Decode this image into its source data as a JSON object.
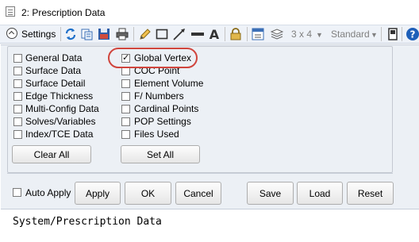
{
  "window": {
    "title": "2: Prescription Data"
  },
  "toolbar": {
    "settings_label": "Settings",
    "layout_value": "3 x 4",
    "style_value": "Standard",
    "icons": [
      "chevron-up-icon",
      "refresh-icon",
      "copy-icon",
      "save-icon",
      "print-icon",
      "pencil-icon",
      "rectangle-icon",
      "line-icon",
      "thick-line-icon",
      "text-icon",
      "lock-icon",
      "window-icon",
      "layers-icon",
      "dropdown-arrow-icon",
      "dropdown-arrow-icon",
      "panel-icon",
      "help-icon"
    ]
  },
  "options": {
    "left": [
      {
        "label": "General Data",
        "checked": false
      },
      {
        "label": "Surface Data",
        "checked": false
      },
      {
        "label": "Surface Detail",
        "checked": false
      },
      {
        "label": "Edge Thickness",
        "checked": false
      },
      {
        "label": "Multi-Config Data",
        "checked": false
      },
      {
        "label": "Solves/Variables",
        "checked": false
      },
      {
        "label": "Index/TCE Data",
        "checked": false
      }
    ],
    "right": [
      {
        "label": "Global Vertex",
        "checked": true
      },
      {
        "label": "COC Point",
        "checked": false
      },
      {
        "label": "Element Volume",
        "checked": false
      },
      {
        "label": "F/ Numbers",
        "checked": false
      },
      {
        "label": "Cardinal Points",
        "checked": false
      },
      {
        "label": "POP Settings",
        "checked": false
      },
      {
        "label": "Files Used",
        "checked": false
      }
    ]
  },
  "buttons": {
    "clear_all": "Clear All",
    "set_all": "Set All",
    "auto_apply": "Auto Apply",
    "apply": "Apply",
    "ok": "OK",
    "cancel": "Cancel",
    "save": "Save",
    "load": "Load",
    "reset": "Reset"
  },
  "output": {
    "text": "System/Prescription Data"
  },
  "colors": {
    "highlight": "#d0453d",
    "panel": "#ecf0f5",
    "toolbar": "#eef2f8"
  }
}
